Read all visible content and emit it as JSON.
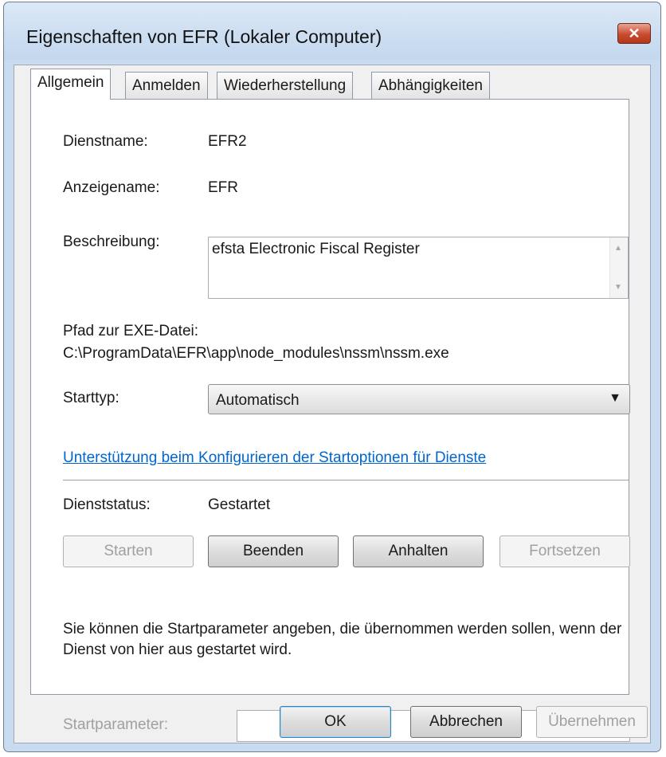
{
  "window": {
    "title": "Eigenschaften von EFR (Lokaler Computer)",
    "close_symbol": "✕"
  },
  "tabs": [
    {
      "label": "Allgemein",
      "active": true
    },
    {
      "label": "Anmelden",
      "active": false
    },
    {
      "label": "Wiederherstellung",
      "active": false
    },
    {
      "label": "Abhängigkeiten",
      "active": false
    }
  ],
  "general": {
    "service_name_label": "Dienstname:",
    "service_name_value": "EFR2",
    "display_name_label": "Anzeigename:",
    "display_name_value": "EFR",
    "description_label": "Beschreibung:",
    "description_value": "efsta Electronic Fiscal Register",
    "path_label": "Pfad zur EXE-Datei:",
    "path_value": "C:\\ProgramData\\EFR\\app\\node_modules\\nssm\\nssm.exe",
    "startup_type_label": "Starttyp:",
    "startup_type_value": "Automatisch",
    "help_link": "Unterstützung beim Konfigurieren der Startoptionen für Dienste",
    "status_label": "Dienststatus:",
    "status_value": "Gestartet",
    "buttons": {
      "start": "Starten",
      "stop": "Beenden",
      "pause": "Anhalten",
      "resume": "Fortsetzen"
    },
    "params_hint": "Sie können die Startparameter angeben, die übernommen werden sollen, wenn der Dienst von hier aus gestartet wird.",
    "start_params_label": "Startparameter:",
    "start_params_value": ""
  },
  "footer": {
    "ok": "OK",
    "cancel": "Abbrechen",
    "apply": "Übernehmen"
  },
  "icons": {
    "close": "close-icon",
    "scroll_up": "scroll-up-arrow-icon",
    "scroll_down": "scroll-down-arrow-icon",
    "dropdown": "chevron-down-icon"
  },
  "colors": {
    "link": "#0066cc",
    "close_button": "#c94b2e",
    "window_frame": "#c9dbee"
  }
}
